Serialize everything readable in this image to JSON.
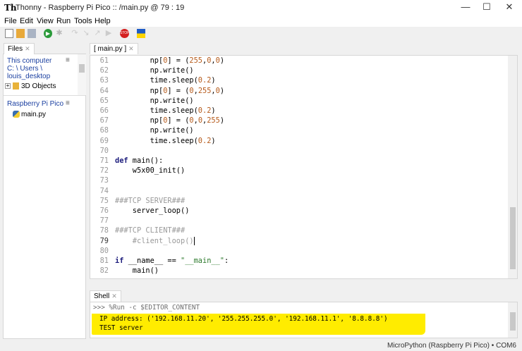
{
  "window": {
    "logo": "Th",
    "title": "Thonny  -  Raspberry Pi Pico :: /main.py  @  79 : 19",
    "minimize": "—",
    "maximize": "☐",
    "close": "✕"
  },
  "menu": [
    "File",
    "Edit",
    "View",
    "Run",
    "Tools",
    "Help"
  ],
  "toolbar": [
    "new-file",
    "open-file",
    "save",
    "run",
    "debug",
    "step-over",
    "step-into",
    "step-out",
    "resume",
    "stop",
    "ukraine-flag"
  ],
  "files": {
    "tab": "Files",
    "computer_header": "This computer",
    "computer_path1": "C: \\ Users \\",
    "computer_path2": "louis_desktop",
    "folder": "3D Objects",
    "pico_header": "Raspberry Pi Pico",
    "pico_file": "main.py",
    "menu_glyph": "≡"
  },
  "editor": {
    "tab": "[ main.py ]",
    "current_line": 79,
    "lines": [
      {
        "n": "61",
        "tokens": [
          [
            "        np[",
            ""
          ],
          [
            "0",
            "num"
          ],
          [
            "] = (",
            ""
          ],
          [
            "255",
            "num"
          ],
          [
            ",",
            ""
          ],
          [
            "0",
            "num"
          ],
          [
            ",",
            ""
          ],
          [
            "0",
            "num"
          ],
          [
            ")",
            ""
          ]
        ]
      },
      {
        "n": "62",
        "tokens": [
          [
            "        np.write()",
            ""
          ]
        ]
      },
      {
        "n": "63",
        "tokens": [
          [
            "        time.sleep(",
            ""
          ],
          [
            "0.2",
            "num"
          ],
          [
            ")",
            ""
          ]
        ]
      },
      {
        "n": "64",
        "tokens": [
          [
            "        np[",
            ""
          ],
          [
            "0",
            "num"
          ],
          [
            "] = (",
            ""
          ],
          [
            "0",
            "num"
          ],
          [
            ",",
            ""
          ],
          [
            "255",
            "num"
          ],
          [
            ",",
            ""
          ],
          [
            "0",
            "num"
          ],
          [
            ")",
            ""
          ]
        ]
      },
      {
        "n": "65",
        "tokens": [
          [
            "        np.write()",
            ""
          ]
        ]
      },
      {
        "n": "66",
        "tokens": [
          [
            "        time.sleep(",
            ""
          ],
          [
            "0.2",
            "num"
          ],
          [
            ")",
            ""
          ]
        ]
      },
      {
        "n": "67",
        "tokens": [
          [
            "        np[",
            ""
          ],
          [
            "0",
            "num"
          ],
          [
            "] = (",
            ""
          ],
          [
            "0",
            "num"
          ],
          [
            ",",
            ""
          ],
          [
            "0",
            "num"
          ],
          [
            ",",
            ""
          ],
          [
            "255",
            "num"
          ],
          [
            ")",
            ""
          ]
        ]
      },
      {
        "n": "68",
        "tokens": [
          [
            "        np.write()",
            ""
          ]
        ]
      },
      {
        "n": "69",
        "tokens": [
          [
            "        time.sleep(",
            ""
          ],
          [
            "0.2",
            "num"
          ],
          [
            ")",
            ""
          ]
        ]
      },
      {
        "n": "70",
        "tokens": []
      },
      {
        "n": "71",
        "tokens": [
          [
            "def",
            "kw"
          ],
          [
            " main():",
            ""
          ]
        ]
      },
      {
        "n": "72",
        "tokens": [
          [
            "    w5x00_init()",
            ""
          ]
        ]
      },
      {
        "n": "73",
        "tokens": []
      },
      {
        "n": "74",
        "tokens": []
      },
      {
        "n": "75",
        "tokens": [
          [
            "###TCP SERVER###",
            "cm"
          ]
        ]
      },
      {
        "n": "76",
        "tokens": [
          [
            "    server_loop()",
            ""
          ]
        ]
      },
      {
        "n": "77",
        "tokens": []
      },
      {
        "n": "78",
        "tokens": [
          [
            "###TCP CLIENT###",
            "cm"
          ]
        ]
      },
      {
        "n": "79",
        "tokens": [
          [
            "    #client_loop()",
            "cm"
          ]
        ]
      },
      {
        "n": "80",
        "tokens": []
      },
      {
        "n": "81",
        "tokens": [
          [
            "if",
            "kw"
          ],
          [
            " __name__ == ",
            ""
          ],
          [
            "\"__main__\"",
            "st"
          ],
          [
            ":",
            ""
          ]
        ]
      },
      {
        "n": "82",
        "tokens": [
          [
            "    main()",
            ""
          ]
        ]
      }
    ]
  },
  "shell": {
    "tab": "Shell",
    "prompt_line": ">>> %Run -c $EDITOR_CONTENT",
    "output": [
      "IP address: ('192.168.11.20', '255.255.255.0', '192.168.11.1', '8.8.8.8')",
      "TEST server"
    ]
  },
  "status": {
    "interpreter": "MicroPython (Raspberry Pi Pico)",
    "sep": "•",
    "port": "COM6"
  }
}
